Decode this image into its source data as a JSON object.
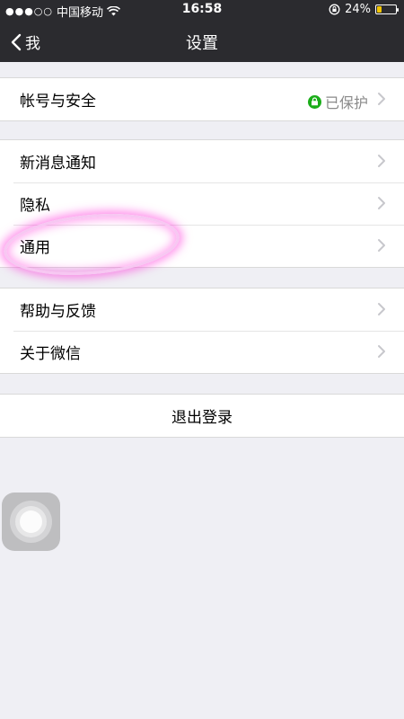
{
  "status_bar": {
    "carrier": "中国移动",
    "time": "16:58",
    "battery_percent": "24%",
    "battery_level": 0.24,
    "icons": [
      "signal-dots-icon",
      "wifi-icon",
      "rotation-lock-icon",
      "battery-icon"
    ]
  },
  "nav": {
    "back_label": "我",
    "title": "设置"
  },
  "groups": [
    {
      "rows": [
        {
          "label": "帐号与安全",
          "value": "已保护"
        }
      ]
    },
    {
      "rows": [
        {
          "label": "新消息通知"
        },
        {
          "label": "隐私"
        },
        {
          "label": "通用"
        }
      ]
    },
    {
      "rows": [
        {
          "label": "帮助与反馈"
        },
        {
          "label": "关于微信"
        }
      ]
    }
  ],
  "logout_label": "退出登录",
  "colors": {
    "nav_bg": "#2b2b2f",
    "page_bg": "#efeff4",
    "protect_green": "#1aad19",
    "highlight": "#ff3cdc",
    "battery_yellow": "#f2c500"
  }
}
